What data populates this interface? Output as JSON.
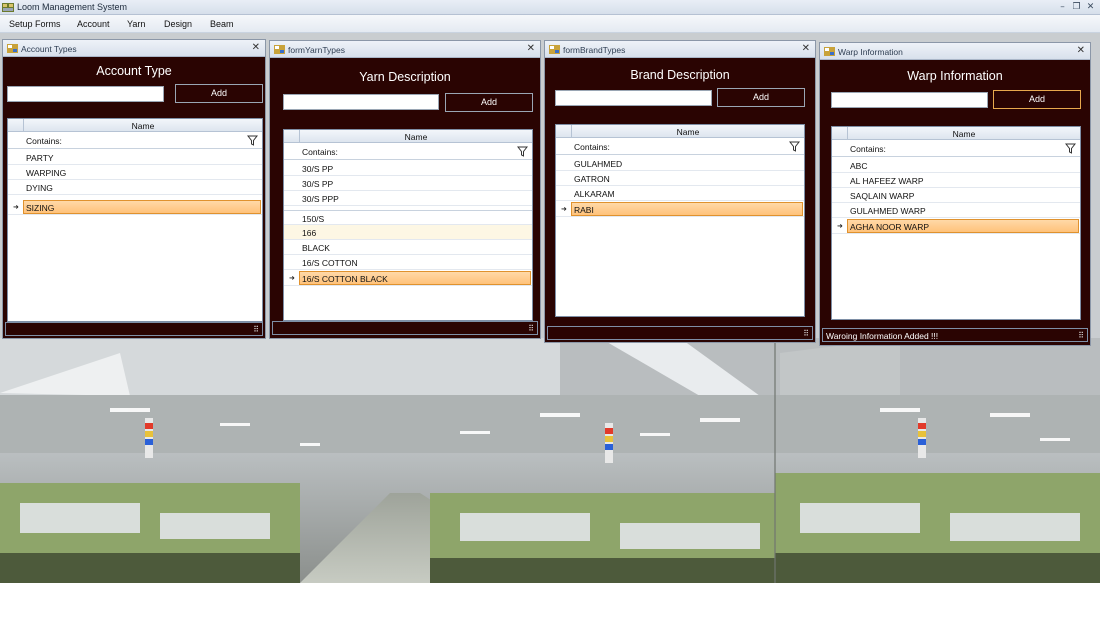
{
  "app": {
    "title": "Loom Management System"
  },
  "menu": [
    "Setup Forms",
    "Account",
    "Yarn",
    "Design",
    "Beam"
  ],
  "windows": {
    "account": {
      "title": "Account Types",
      "heading": "Account Type",
      "add_label": "Add",
      "column": "Name",
      "filter_label": "Contains:",
      "rows": [
        "PARTY",
        "WARPING",
        "DYING",
        "SIZING"
      ],
      "status": ""
    },
    "yarn": {
      "title": "formYarnTypes",
      "heading": "Yarn Description",
      "add_label": "Add",
      "column": "Name",
      "filter_label": "Contains:",
      "rows": [
        "30/S PP",
        "30/S PP",
        "30/S PPP",
        "150/S",
        "166",
        "BLACK",
        "16/S COTTON",
        "16/S COTTON BLACK"
      ],
      "status": ""
    },
    "brand": {
      "title": "formBrandTypes",
      "heading": "Brand Description",
      "add_label": "Add",
      "column": "Name",
      "filter_label": "Contains:",
      "rows": [
        "GULAHMED",
        "GATRON",
        "ALKARAM",
        "RABI"
      ],
      "status": ""
    },
    "warp": {
      "title": "Warp Information",
      "heading": "Warp Information",
      "add_label": "Add",
      "column": "Name",
      "filter_label": "Contains:",
      "rows": [
        "ABC",
        "AL HAFEEZ WARP",
        "SAQLAIN WARP",
        "GULAHMED WARP",
        "AGHA NOOR WARP"
      ],
      "status": "Waroing Information Added !!!"
    }
  },
  "icons": {
    "app": "loom-app-icon",
    "filter": "funnel-icon",
    "row_pointer": "current-row-arrow-icon",
    "close": "close-icon",
    "grip": "resize-grip-icon"
  },
  "colors": {
    "window_bg": "#2a0402",
    "selected_row": "#ffc27a",
    "selected_border": "#e0922e"
  }
}
